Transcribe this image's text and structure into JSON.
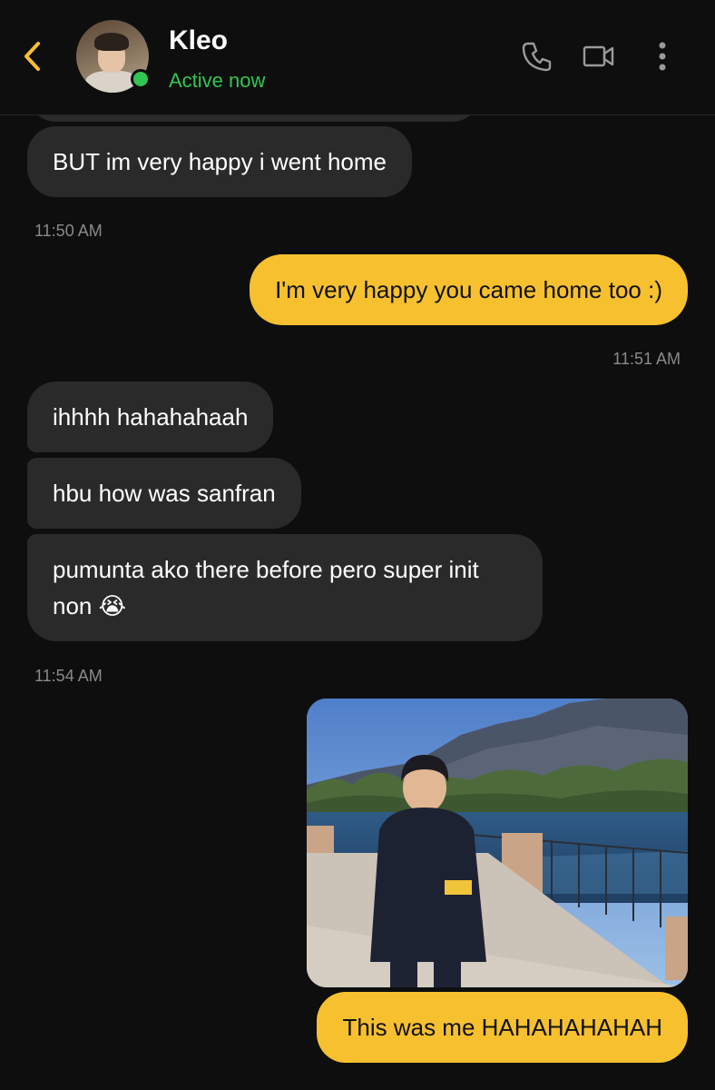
{
  "header": {
    "back_icon": "chevron-left-icon",
    "contact_name": "Kleo",
    "status": "Active now",
    "call_icon": "phone-icon",
    "video_icon": "video-camera-icon",
    "more_icon": "more-vertical-icon"
  },
  "colors": {
    "accent": "#f6c02f",
    "online": "#31c553",
    "incoming_bubble": "#2a2a2a",
    "background": "#0e0e0e"
  },
  "messages": [
    {
      "type": "incoming",
      "text": "BUT im very happy i went home"
    },
    {
      "type": "timestamp",
      "text": "11:50 AM"
    },
    {
      "type": "outgoing",
      "text": "I'm very happy you came home too :)"
    },
    {
      "type": "timestamp",
      "text": "11:51 AM"
    },
    {
      "type": "incoming",
      "text": "ihhhh hahahahaah"
    },
    {
      "type": "incoming",
      "text": "hbu how was sanfran"
    },
    {
      "type": "incoming",
      "text": "pumunta ako there before pero super init non 😭"
    },
    {
      "type": "timestamp",
      "text": "11:54 AM"
    },
    {
      "type": "outgoing-image",
      "image": "photo of person standing by a lake with mountains"
    },
    {
      "type": "outgoing",
      "text": "This was me HAHAHAHAHAH"
    }
  ]
}
